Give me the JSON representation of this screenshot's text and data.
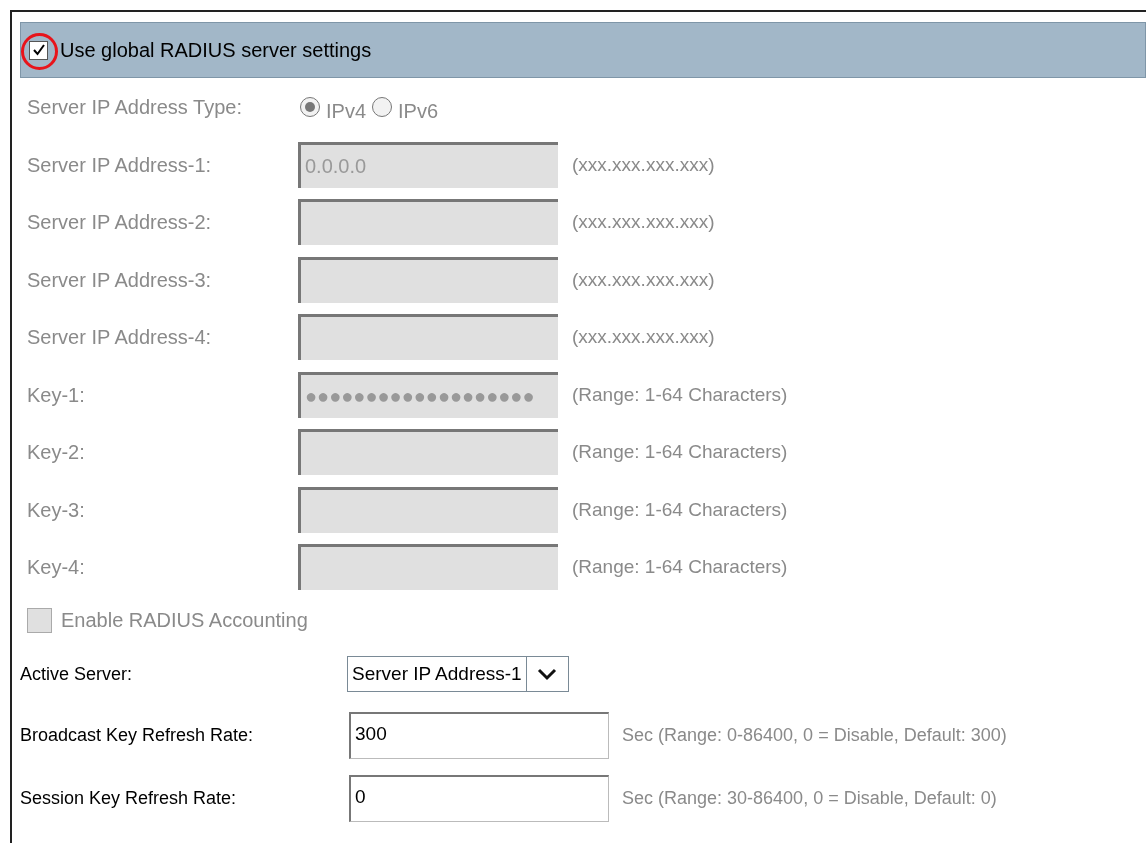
{
  "global_settings": {
    "label": "Use global RADIUS server settings",
    "checked": true,
    "highlighted": true
  },
  "ip_type": {
    "label": "Server IP Address Type:",
    "disabled": true,
    "options": [
      {
        "label": "IPv4",
        "selected": true
      },
      {
        "label": "IPv6",
        "selected": false
      }
    ]
  },
  "fields": [
    {
      "label": "Server IP Address-1:",
      "value": "0.0.0.0",
      "hint": "(xxx.xxx.xxx.xxx)",
      "disabled": true
    },
    {
      "label": "Server IP Address-2:",
      "hint": "(xxx.xxx.xxx.xxx)",
      "disabled": true
    },
    {
      "label": "Server IP Address-3:",
      "hint": "(xxx.xxx.xxx.xxx)",
      "disabled": true
    },
    {
      "label": "Server IP Address-4:",
      "hint": "(xxx.xxx.xxx.xxx)",
      "disabled": true
    },
    {
      "label": "Key-1:",
      "value": "●●●●●●●●●●●●●●●●●●●",
      "hint": "(Range: 1-64 Characters)",
      "disabled": true
    },
    {
      "label": "Key-2:",
      "hint": "(Range: 1-64 Characters)",
      "disabled": true
    },
    {
      "label": "Key-3:",
      "hint": "(Range: 1-64 Characters)",
      "disabled": true
    },
    {
      "label": "Key-4:",
      "hint": "(Range: 1-64 Characters)",
      "disabled": true
    }
  ],
  "accounting": {
    "label": "Enable RADIUS Accounting",
    "checked": false,
    "disabled": true
  },
  "active_server": {
    "label": "Active Server:",
    "value": "Server IP Address-1"
  },
  "refresh": [
    {
      "label": "Broadcast Key Refresh Rate:",
      "value": "300",
      "hint": "Sec (Range: 0-86400, 0 = Disable, Default: 300)"
    },
    {
      "label": "Session Key Refresh Rate:",
      "value": "0",
      "hint": "Sec (Range: 30-86400, 0 = Disable, Default: 0)"
    }
  ]
}
